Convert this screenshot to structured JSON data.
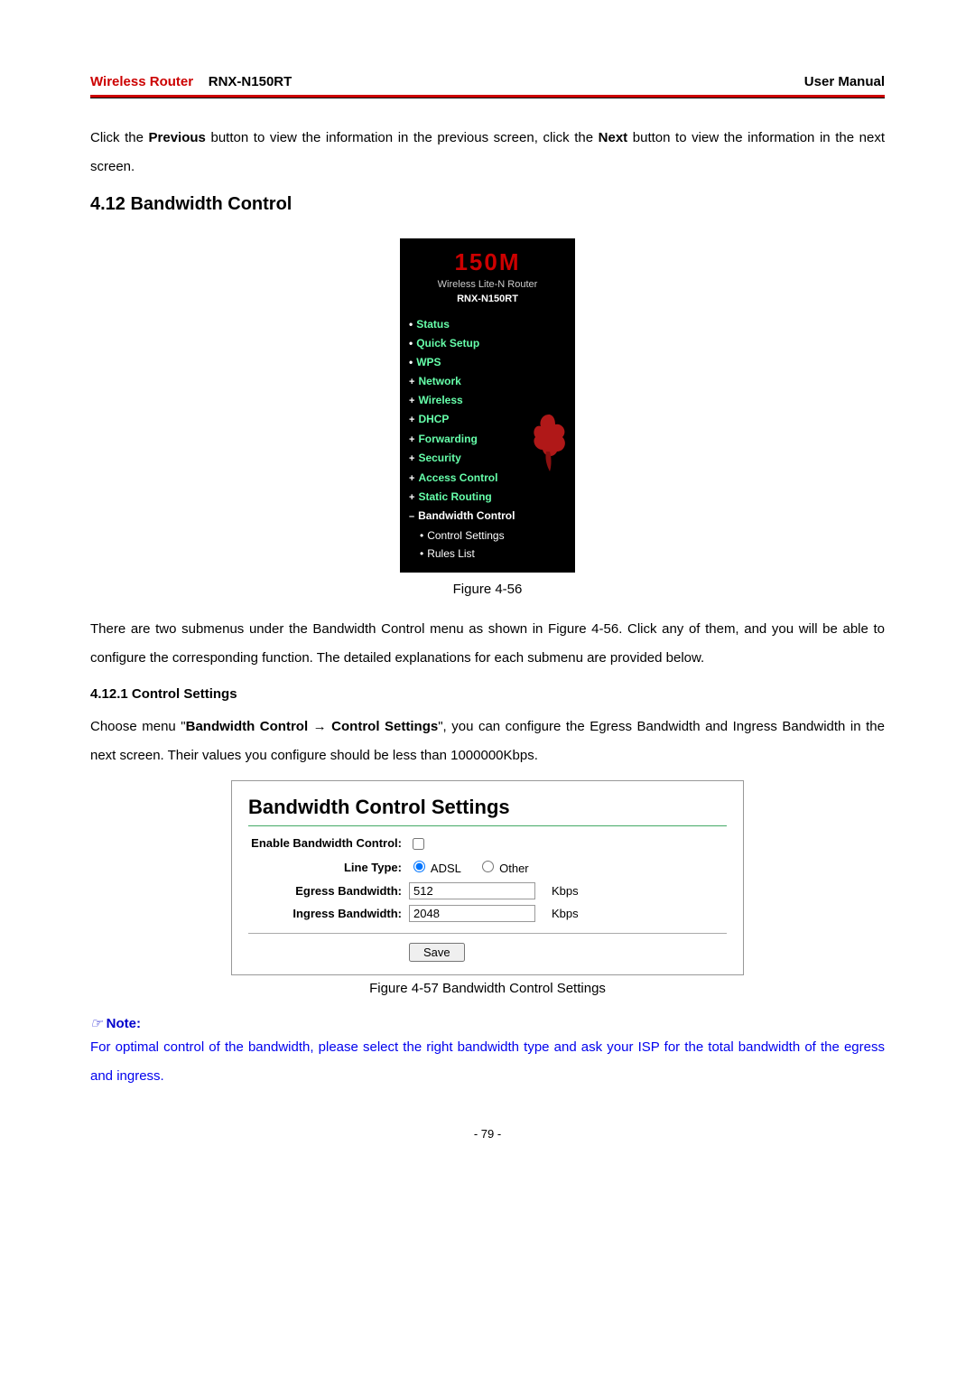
{
  "header": {
    "left_red": "Wireless Router",
    "left_model": "RNX-N150RT",
    "right": "User Manual"
  },
  "para1_a": "Click the ",
  "para1_b": "Previous",
  "para1_c": " button to view the information in the previous screen, click the ",
  "para1_d": "Next",
  "para1_e": " button to view the information in the next screen.",
  "section_heading": "4.12 Bandwidth Control",
  "menu": {
    "logo": "150M",
    "sub1": "Wireless Lite-N Router",
    "sub2": "RNX-N150RT",
    "items": [
      "Status",
      "Quick Setup",
      "WPS",
      "Network",
      "Wireless",
      "DHCP",
      "Forwarding",
      "Security",
      "Access Control",
      "Static Routing",
      "Bandwidth Control"
    ],
    "subitems": [
      "Control Settings",
      "Rules List"
    ]
  },
  "fig1_caption": "Figure 4-56",
  "para2": "There are two submenus under the Bandwidth Control menu as shown in Figure 4-56. Click any of them, and you will be able to configure the corresponding function. The detailed explanations for each submenu are provided below.",
  "subsection_heading": "4.12.1 Control Settings",
  "para3_a": "Choose menu \"",
  "para3_b": "Bandwidth Control → Control Settings",
  "para3_c": "\", you can configure the Egress Bandwidth and Ingress Bandwidth in the next screen. Their values you configure should be less than 1000000Kbps.",
  "panel": {
    "title": "Bandwidth Control Settings",
    "enable_label": "Enable Bandwidth Control:",
    "line_type_label": "Line Type:",
    "radio1": "ADSL",
    "radio2": "Other",
    "egress_label": "Egress Bandwidth:",
    "egress_value": "512",
    "ingress_label": "Ingress Bandwidth:",
    "ingress_value": "2048",
    "unit": "Kbps",
    "save": "Save"
  },
  "fig2_caption": "Figure 4-57 Bandwidth Control Settings",
  "note_symbol": "☞",
  "note_label": "Note:",
  "note_text": "For optimal control of the bandwidth, please select the right bandwidth type and ask your ISP for the total bandwidth of the egress and ingress.",
  "page_num": "- 79 -"
}
